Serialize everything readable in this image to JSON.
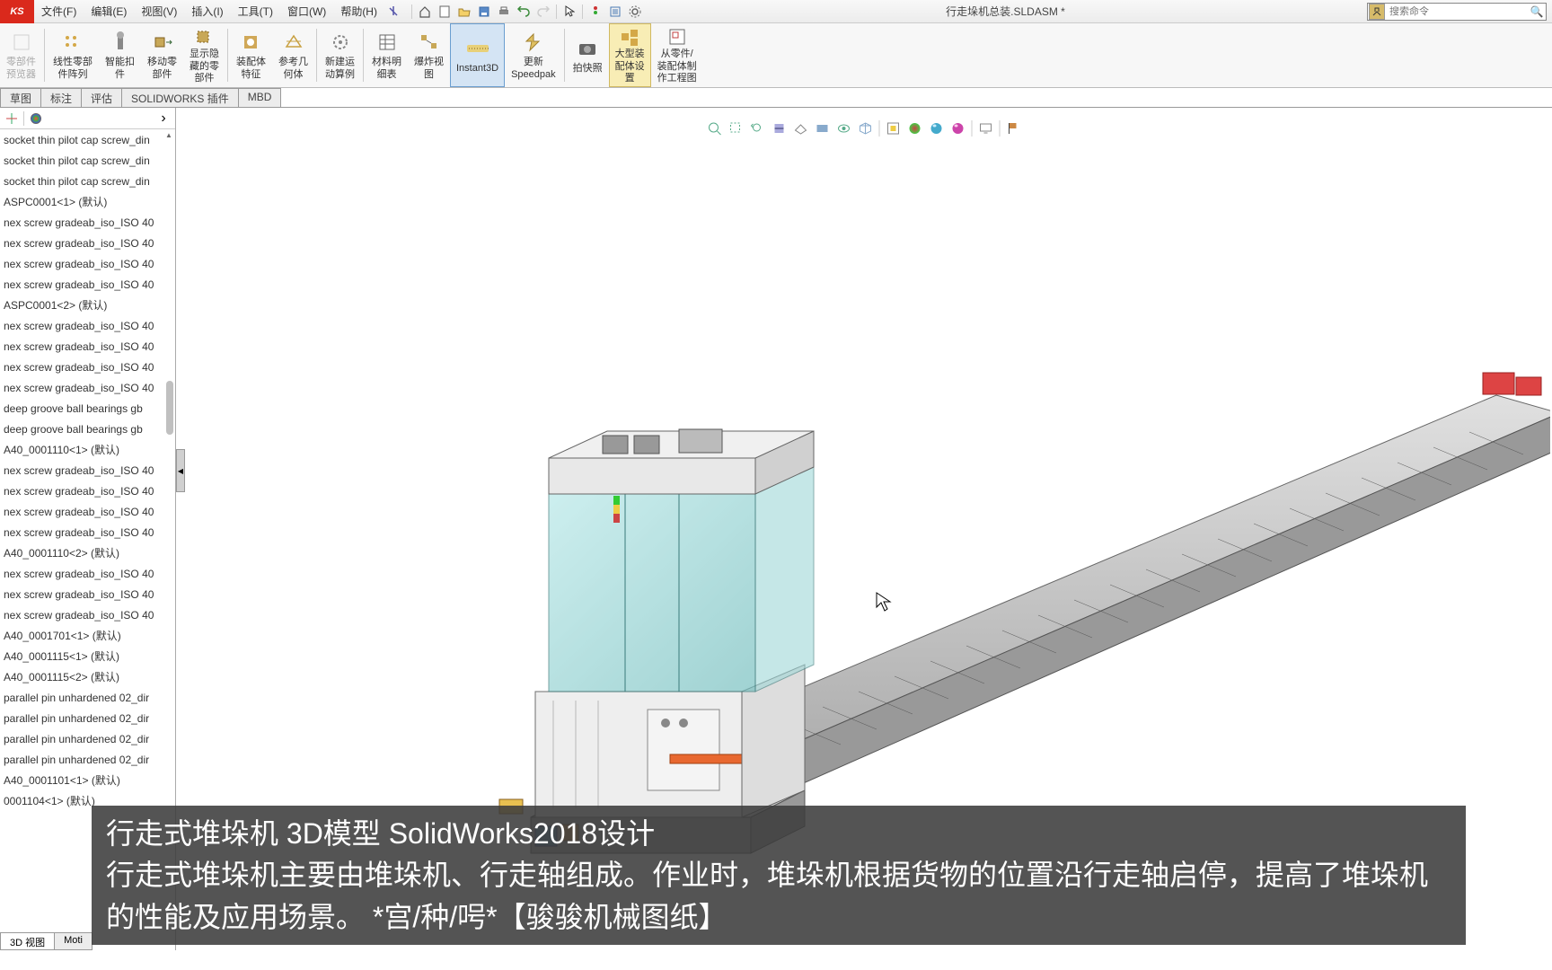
{
  "app": {
    "logo": "KS",
    "title": "行走垛机总装.SLDASM *"
  },
  "menu": {
    "file": "文件(F)",
    "edit": "编辑(E)",
    "view": "视图(V)",
    "insert": "插入(I)",
    "tools": "工具(T)",
    "window": "窗口(W)",
    "help": "帮助(H)"
  },
  "search": {
    "placeholder": "搜索命令"
  },
  "ribbon": {
    "btn0": "零部件\n预览器",
    "btn1": "线性零部\n件阵列",
    "btn2": "智能扣\n件",
    "btn3": "移动零\n部件",
    "btn4": "显示隐\n藏的零\n部件",
    "btn5": "装配体\n特征",
    "btn6": "参考几\n何体",
    "btn7": "新建运\n动算例",
    "btn8": "材料明\n细表",
    "btn9": "爆炸视\n图",
    "btn10": "Instant3D",
    "btn11": "更新\nSpeedpak",
    "btn12": "拍快照",
    "btn13": "大型装\n配体设\n置",
    "btn14": "从零件/\n装配体制\n作工程图"
  },
  "tabs": {
    "t0": "草图",
    "t1": "标注",
    "t2": "评估",
    "t3": "SOLIDWORKS 插件",
    "t4": "MBD"
  },
  "tree": {
    "items": [
      "socket thin pilot cap screw_din",
      "socket thin pilot cap screw_din",
      "socket thin pilot cap screw_din",
      "ASPC0001<1> (默认)",
      "nex screw gradeab_iso_ISO 40",
      "nex screw gradeab_iso_ISO 40",
      "nex screw gradeab_iso_ISO 40",
      "nex screw gradeab_iso_ISO 40",
      "ASPC0001<2> (默认)",
      "nex screw gradeab_iso_ISO 40",
      "nex screw gradeab_iso_ISO 40",
      "nex screw gradeab_iso_ISO 40",
      "nex screw gradeab_iso_ISO 40",
      "deep groove ball bearings gb",
      "deep groove ball bearings gb",
      "A40_0001110<1> (默认)",
      "nex screw gradeab_iso_ISO 40",
      "nex screw gradeab_iso_ISO 40",
      "nex screw gradeab_iso_ISO 40",
      "nex screw gradeab_iso_ISO 40",
      "A40_0001110<2> (默认)",
      "nex screw gradeab_iso_ISO 40",
      "nex screw gradeab_iso_ISO 40",
      "nex screw gradeab_iso_ISO 40",
      "A40_0001701<1> (默认)",
      "A40_0001115<1> (默认)",
      "A40_0001115<2> (默认)",
      "parallel pin unhardened 02_dir",
      "parallel pin unhardened 02_dir",
      "parallel pin unhardened 02_dir",
      "parallel pin unhardened 02_dir",
      "A40_0001101<1> (默认)",
      "0001104<1> (默认)"
    ]
  },
  "bottom_tabs": {
    "b0": "3D 视图",
    "b1": "Moti"
  },
  "caption": {
    "line1": "行走式堆垛机 3D模型    SolidWorks2018设计",
    "line2": "行走式堆垛机主要由堆垛机、行走轴组成。作业时，堆垛机根据货物的位置沿行走轴启停，提高了堆垛机的性能及应用场景。 *宫/种/呺*【骏骏机械图纸】"
  }
}
